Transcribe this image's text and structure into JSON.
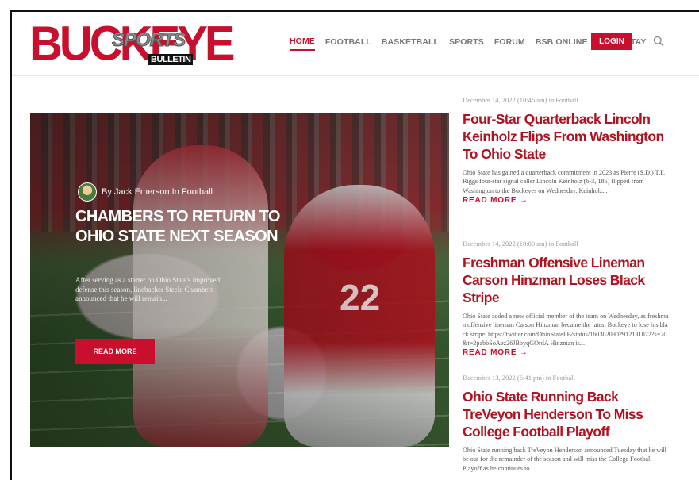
{
  "brand": {
    "logo_main": "BUCKEYE",
    "logo_sports": "SPORTS",
    "logo_bulletin": "BULLETIN",
    "accent": "#c8102e"
  },
  "nav": {
    "items": [
      "HOME",
      "FOOTBALL",
      "BASKETBALL",
      "SPORTS",
      "FORUM",
      "BSB ONLINE",
      "EAT & STAY"
    ],
    "active": "HOME",
    "login": "LOGIN",
    "search_icon": "search-icon"
  },
  "hero": {
    "byline": "By Jack Emerson In Football",
    "title": "CHAMBERS TO RETURN TO OHIO STATE NEXT SEASON",
    "excerpt": "After serving as a starter on Ohio State's improved defense this season, linebacker Steele Chambers announced that he will remain...",
    "button": "READ MORE",
    "jersey_number": "22"
  },
  "articles": [
    {
      "meta": "December 14, 2022 (10:46 am) in Football",
      "title": "Four-Star Quarterback Lincoln Keinholz Flips From Washington To Ohio State",
      "excerpt": "Ohio State has gained a quarterback commitment in 2023 as Pierre (S.D.) T.F. Riggs four-star signal caller Lincoln Keinholz (6-3, 185) flipped from Washington to the Buckeyes on Wednesday. Keinholz...",
      "more": "READ MORE →"
    },
    {
      "meta": "December 14, 2022 (10:00 am) in Football",
      "title": "Freshman Offensive Lineman Carson Hinzman Loses Black Stripe",
      "excerpt": "Ohio State added a new official member of the team on Wednesday, as freshman offensive lineman Carson Hinzman became the latest Buckeye to lose his black stripe. https://twitter.com/OhioStateFB/status/1603020902912131072?s=20&t=2pabbSoAez26JBbyqGOrdA Hinzman is...",
      "more": "READ MORE →"
    },
    {
      "meta": "December 13, 2022 (6:41 pm) in Football",
      "title": "Ohio State Running Back TreVeyon Henderson To Miss College Football Playoff",
      "excerpt": "Ohio State running back TreVeyon Henderson announced Tuesday that he will be out for the remainder of the season and will miss the College Football Playoff as he continues to...",
      "more": ""
    }
  ]
}
